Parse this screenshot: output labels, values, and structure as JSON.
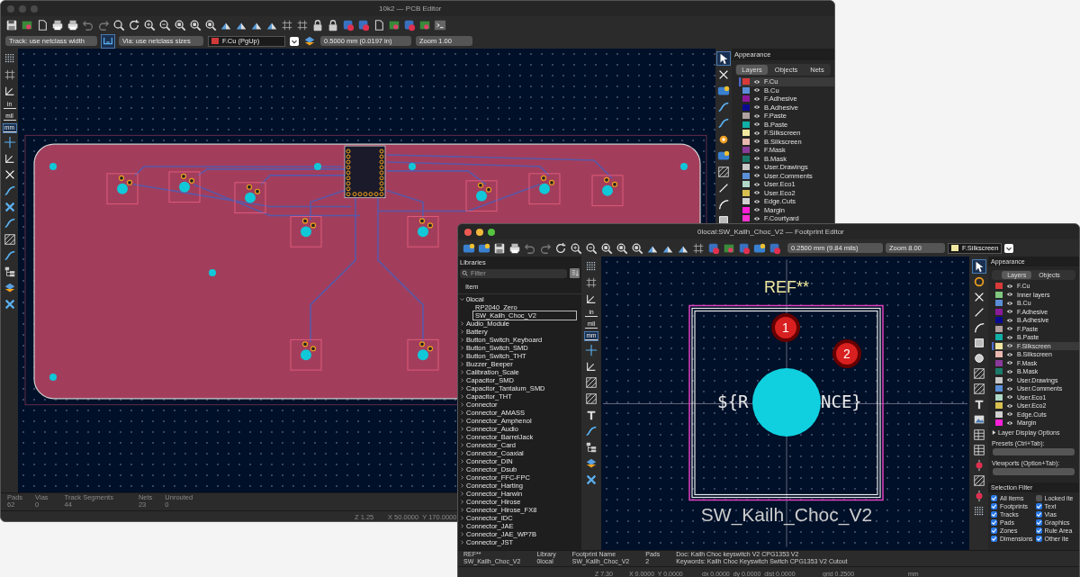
{
  "pcb_editor": {
    "title": "10k2 — PCB Editor",
    "track_width": "Track: use netclass width",
    "via_size": "Via: use netclass sizes",
    "active_layer": {
      "name": "F.Cu (PgUp)",
      "color": "#d03a3a"
    },
    "grid": "0.5000 mm (0.0197 in)",
    "zoom": "Zoom 1.00",
    "units": [
      {
        "label": "in",
        "selected": false
      },
      {
        "label": "mil",
        "selected": false
      },
      {
        "label": "mm",
        "selected": true
      }
    ],
    "appearance": {
      "title": "Appearance",
      "tabs": [
        {
          "label": "Layers",
          "selected": true
        },
        {
          "label": "Objects",
          "selected": false
        },
        {
          "label": "Nets",
          "selected": false
        }
      ],
      "layers": [
        {
          "name": "F.Cu",
          "color": "#d83a3a",
          "selected": true
        },
        {
          "name": "B.Cu",
          "color": "#5a8fd8",
          "selected": false
        },
        {
          "name": "F.Adhesive",
          "color": "#8b1a9a",
          "selected": false
        },
        {
          "name": "B.Adhesive",
          "color": "#0a0a90",
          "selected": false
        },
        {
          "name": "F.Paste",
          "color": "#b0a0a0",
          "selected": false
        },
        {
          "name": "B.Paste",
          "color": "#10b0a8",
          "selected": false
        },
        {
          "name": "F.Silkscreen",
          "color": "#f0e8a0",
          "selected": false
        },
        {
          "name": "B.Silkscreen",
          "color": "#e8b8b0",
          "selected": false
        },
        {
          "name": "F.Mask",
          "color": "#8a3a9a",
          "selected": false
        },
        {
          "name": "B.Mask",
          "color": "#1a7a6a",
          "selected": false
        },
        {
          "name": "User.Drawings",
          "color": "#c8c8c8",
          "selected": false
        },
        {
          "name": "User.Comments",
          "color": "#5a90d8",
          "selected": false
        },
        {
          "name": "User.Eco1",
          "color": "#b0d8c8",
          "selected": false
        },
        {
          "name": "User.Eco2",
          "color": "#d8c050",
          "selected": false
        },
        {
          "name": "Edge.Cuts",
          "color": "#d0d0d0",
          "selected": false
        },
        {
          "name": "Margin",
          "color": "#ff20d8",
          "selected": false
        },
        {
          "name": "F.Courtyard",
          "color": "#ff30d0",
          "selected": false
        }
      ]
    },
    "stats": [
      {
        "label": "Pads",
        "value": "62"
      },
      {
        "label": "Vias",
        "value": "0"
      },
      {
        "label": "Track Segments",
        "value": "44"
      },
      {
        "label": "Nets",
        "value": "23"
      },
      {
        "label": "Unrouted",
        "value": "0"
      }
    ],
    "status": {
      "zoom": "Z 1.25",
      "coords": "X 50.0000  Y 170.0000"
    }
  },
  "footprint_editor": {
    "title": "0local:SW_Kailh_Choc_V2 — Footprint Editor",
    "grid": "0.2500 mm (9.84 mils)",
    "zoom": "Zoom 8.00",
    "active_layer": {
      "name": "F.Silkscreen",
      "color": "#f0e8a0"
    },
    "units": [
      {
        "label": "in",
        "selected": false
      },
      {
        "label": "mil",
        "selected": false
      },
      {
        "label": "mm",
        "selected": true
      }
    ],
    "libraries": {
      "title": "Libraries",
      "filter_placeholder": "Filter",
      "column": "Item",
      "tree": [
        {
          "name": "0local",
          "expanded": true,
          "children": [
            {
              "name": "RP2040_Zero",
              "selected": false
            },
            {
              "name": "SW_Kailh_Choc_V2",
              "selected": true
            }
          ]
        },
        {
          "name": "Audio_Module",
          "expanded": false
        },
        {
          "name": "Battery",
          "expanded": false
        },
        {
          "name": "Button_Switch_Keyboard",
          "expanded": false
        },
        {
          "name": "Button_Switch_SMD",
          "expanded": false
        },
        {
          "name": "Button_Switch_THT",
          "expanded": false
        },
        {
          "name": "Buzzer_Beeper",
          "expanded": false
        },
        {
          "name": "Calibration_Scale",
          "expanded": false
        },
        {
          "name": "Capacitor_SMD",
          "expanded": false
        },
        {
          "name": "Capacitor_Tantalum_SMD",
          "expanded": false
        },
        {
          "name": "Capacitor_THT",
          "expanded": false
        },
        {
          "name": "Connector",
          "expanded": false
        },
        {
          "name": "Connector_AMASS",
          "expanded": false
        },
        {
          "name": "Connector_Amphenol",
          "expanded": false
        },
        {
          "name": "Connector_Audio",
          "expanded": false
        },
        {
          "name": "Connector_BarrelJack",
          "expanded": false
        },
        {
          "name": "Connector_Card",
          "expanded": false
        },
        {
          "name": "Connector_Coaxial",
          "expanded": false
        },
        {
          "name": "Connector_DIN",
          "expanded": false
        },
        {
          "name": "Connector_Dsub",
          "expanded": false
        },
        {
          "name": "Connector_FFC-FPC",
          "expanded": false
        },
        {
          "name": "Connector_Harting",
          "expanded": false
        },
        {
          "name": "Connector_Harwin",
          "expanded": false
        },
        {
          "name": "Connector_Hirose",
          "expanded": false
        },
        {
          "name": "Connector_Hirose_FX8",
          "expanded": false
        },
        {
          "name": "Connector_IDC",
          "expanded": false
        },
        {
          "name": "Connector_JAE",
          "expanded": false
        },
        {
          "name": "Connector_JAE_WP7B",
          "expanded": false
        },
        {
          "name": "Connector_JST",
          "expanded": false
        }
      ]
    },
    "canvas": {
      "reference": "REF**",
      "value_left": "${R",
      "value_right": "NCE}",
      "pads": [
        "1",
        "2"
      ],
      "footprint_name": "SW_Kailh_Choc_V2"
    },
    "appearance": {
      "title": "Appearance",
      "tabs": [
        {
          "label": "Layers",
          "selected": true
        },
        {
          "label": "Objects",
          "selected": false
        }
      ],
      "layers": [
        {
          "name": "F.Cu",
          "color": "#d83a3a",
          "selected": false
        },
        {
          "name": "Inner layers",
          "color": "#80c880",
          "selected": false
        },
        {
          "name": "B.Cu",
          "color": "#5a8fd8",
          "selected": false
        },
        {
          "name": "F.Adhesive",
          "color": "#8b1a9a",
          "selected": false
        },
        {
          "name": "B.Adhesive",
          "color": "#0a0a90",
          "selected": false
        },
        {
          "name": "F.Paste",
          "color": "#b0a0a0",
          "selected": false
        },
        {
          "name": "B.Paste",
          "color": "#10b0a8",
          "selected": false
        },
        {
          "name": "F.Silkscreen",
          "color": "#f0e8a0",
          "selected": true
        },
        {
          "name": "B.Silkscreen",
          "color": "#e8b8b0",
          "selected": false
        },
        {
          "name": "F.Mask",
          "color": "#8a3a9a",
          "selected": false
        },
        {
          "name": "B.Mask",
          "color": "#1a7a6a",
          "selected": false
        },
        {
          "name": "User.Drawings",
          "color": "#c8c8c8",
          "selected": false
        },
        {
          "name": "User.Comments",
          "color": "#5a90d8",
          "selected": false
        },
        {
          "name": "User.Eco1",
          "color": "#b0d8c8",
          "selected": false
        },
        {
          "name": "User.Eco2",
          "color": "#d8c050",
          "selected": false
        },
        {
          "name": "Edge.Cuts",
          "color": "#d0d0d0",
          "selected": false
        },
        {
          "name": "Margin",
          "color": "#ff20d8",
          "selected": false
        }
      ],
      "display_options": "Layer Display Options",
      "presets_label": "Presets (Ctrl+Tab):",
      "viewports_label": "Viewports (Option+Tab):",
      "selection_filter": {
        "title": "Selection Filter",
        "items": [
          {
            "label": "All items",
            "checked": true
          },
          {
            "label": "Locked ite",
            "checked": false
          },
          {
            "label": "Footprints",
            "checked": true
          },
          {
            "label": "Text",
            "checked": true
          },
          {
            "label": "Tracks",
            "checked": true
          },
          {
            "label": "Vias",
            "checked": true
          },
          {
            "label": "Pads",
            "checked": true
          },
          {
            "label": "Graphics",
            "checked": true
          },
          {
            "label": "Zones",
            "checked": true
          },
          {
            "label": "Rule Area",
            "checked": true
          },
          {
            "label": "Dimensions",
            "checked": true
          },
          {
            "label": "Other ite",
            "checked": true
          }
        ]
      }
    },
    "info": [
      {
        "label": "REF**",
        "value": "SW_Kailh_Choc_V2"
      },
      {
        "label": "Library",
        "value": "0local"
      },
      {
        "label": "Footprint Name",
        "value": "SW_Kailh_Choc_V2"
      },
      {
        "label": "Pads",
        "value": "2"
      }
    ],
    "doc": "Doc: Kailh Choc keyswitch V2 CPG1353 V2",
    "keywords": "Keywords: Kailh Choc Keyswitch Switch CPG1353 V2 Cutout",
    "status": {
      "zoom": "Z 7.30",
      "coords": "X 0.0000  Y 0.0000",
      "delta": "dx 0.0000  dy 0.0000  dist 0.0000",
      "grid": "grid 0.2500",
      "units": "mm"
    }
  }
}
